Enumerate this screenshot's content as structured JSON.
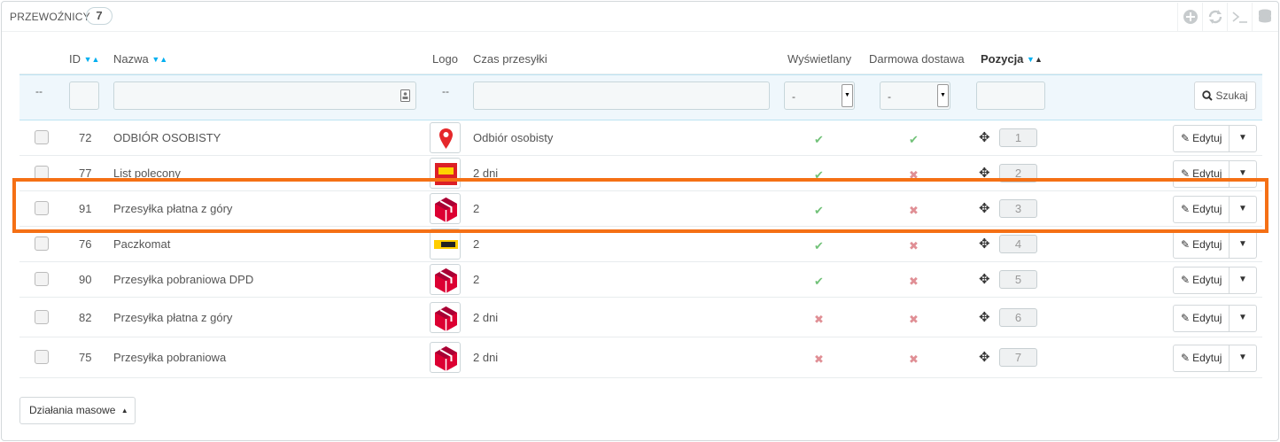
{
  "panel": {
    "title": "PRZEWOŹNICY",
    "count": "7"
  },
  "toolbar": {
    "icons": [
      "plus-circle-icon",
      "refresh-icon",
      "terminal-icon",
      "database-icon"
    ]
  },
  "table": {
    "headers": {
      "id": "ID",
      "name": "Nazwa",
      "logo": "Logo",
      "delay": "Czas przesyłki",
      "active": "Wyświetlany",
      "free": "Darmowa dostawa",
      "position": "Pozycja"
    },
    "filters": {
      "checkbox_placeholder": "--",
      "logo_placeholder": "--",
      "active_select": "-",
      "free_select": "-",
      "search_label": "Szukaj"
    },
    "rows": [
      {
        "id": "72",
        "name": "ODBIÓR OSOBISTY",
        "logo": "pin-logo",
        "delay": "Odbiór osobisty",
        "active": true,
        "free": true,
        "position": "1"
      },
      {
        "id": "77",
        "name": "List polecony",
        "logo": "poczta-polska-logo",
        "delay": "2 dni",
        "active": true,
        "free": false,
        "position": "2"
      },
      {
        "id": "91",
        "name": "Przesyłka płatna z góry",
        "logo": "dpd-logo",
        "delay": "2",
        "active": true,
        "free": false,
        "position": "3"
      },
      {
        "id": "76",
        "name": "Paczkomat",
        "logo": "inpost-logo",
        "delay": "2",
        "active": true,
        "free": false,
        "position": "4"
      },
      {
        "id": "90",
        "name": "Przesyłka pobraniowa DPD",
        "logo": "dpd-logo",
        "delay": "2",
        "active": true,
        "free": false,
        "position": "5"
      },
      {
        "id": "82",
        "name": "Przesyłka płatna z góry",
        "logo": "dpd-logo",
        "delay": "2 dni",
        "active": false,
        "free": false,
        "position": "6"
      },
      {
        "id": "75",
        "name": "Przesyłka pobraniowa",
        "logo": "dpd-logo",
        "delay": "2 dni",
        "active": false,
        "free": false,
        "position": "7"
      }
    ],
    "edit_label": "Edytuj"
  },
  "footer": {
    "bulk_label": "Działania masowe"
  },
  "colors": {
    "highlight": "#f57015",
    "ok": "#72c279",
    "no": "#e08f95",
    "accent": "#00aff0",
    "dpd_red": "#dc0032"
  }
}
